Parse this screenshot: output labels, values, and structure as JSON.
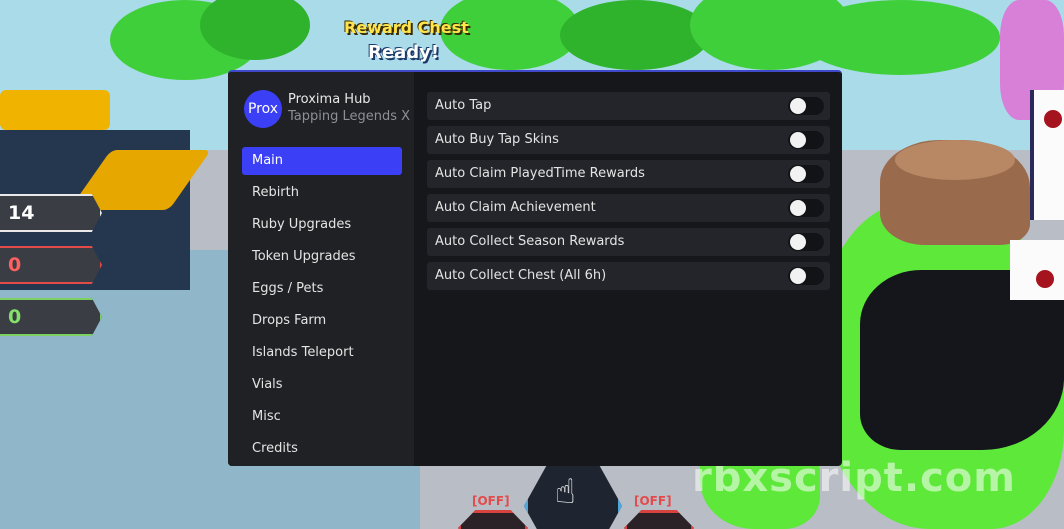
{
  "hub": {
    "avatar_text": "Prox",
    "title": "Proxima Hub",
    "subtitle": "Tapping Legends X",
    "nav": [
      {
        "label": "Main",
        "active": true
      },
      {
        "label": "Rebirth"
      },
      {
        "label": "Ruby Upgrades"
      },
      {
        "label": "Token Upgrades"
      },
      {
        "label": "Eggs / Pets"
      },
      {
        "label": "Drops Farm"
      },
      {
        "label": "Islands Teleport"
      },
      {
        "label": "Vials"
      },
      {
        "label": "Misc"
      },
      {
        "label": "Credits"
      }
    ],
    "toggles": [
      {
        "label": "Auto Tap",
        "on": false
      },
      {
        "label": "Auto Buy Tap Skins",
        "on": false
      },
      {
        "label": "Auto Claim PlayedTime Rewards",
        "on": false
      },
      {
        "label": "Auto Claim Achievement",
        "on": false
      },
      {
        "label": "Auto Collect Season Rewards",
        "on": false
      },
      {
        "label": "Auto Collect Chest (All 6h)",
        "on": false
      }
    ],
    "accent_color": "#3b3ff5"
  },
  "game": {
    "reward_line1": "Reward Chest",
    "reward_line2": "Ready!",
    "stats": {
      "taps": "14",
      "rubies": "0",
      "tokens": "0"
    },
    "off_left": "[OFF]",
    "off_right": "[OFF]",
    "watermark": "rbxscript.com"
  }
}
